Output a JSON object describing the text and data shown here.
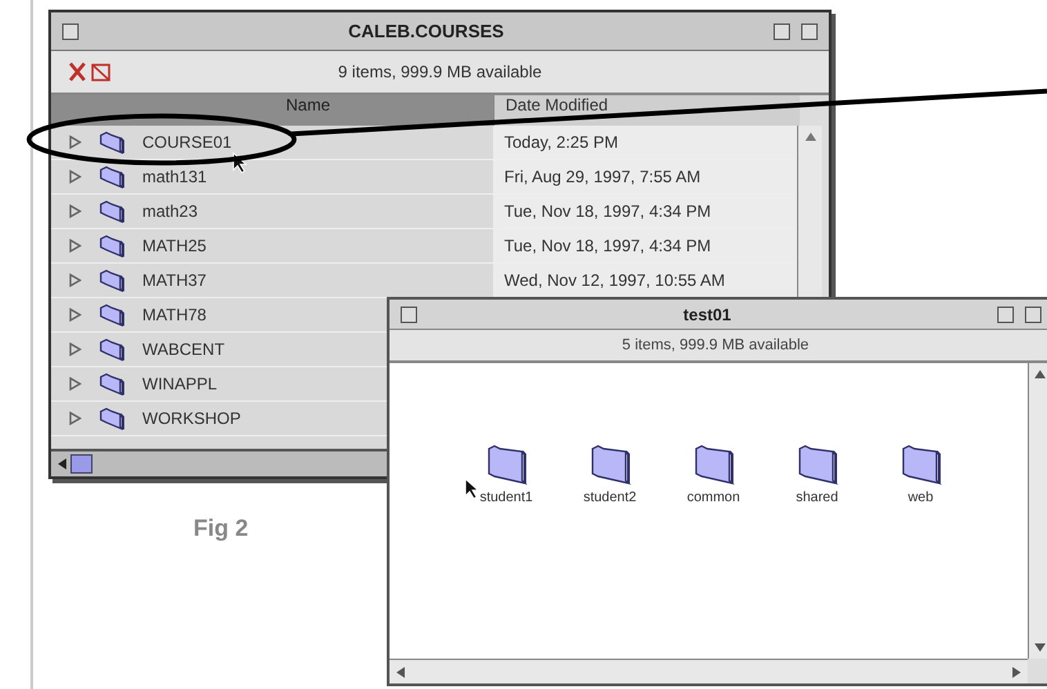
{
  "figure_caption": "Fig 2",
  "windows": [
    {
      "title": "CALEB.COURSES",
      "info": "9 items, 999.9 MB available",
      "columns": [
        "Name",
        "Date Modified"
      ],
      "rows": [
        {
          "name": "COURSE01",
          "date": "Today, 2:25 PM",
          "expanded": false
        },
        {
          "name": "math131",
          "date": "Fri, Aug 29, 1997, 7:55 AM",
          "expanded": false
        },
        {
          "name": "math23",
          "date": "Tue, Nov 18, 1997, 4:34 PM",
          "expanded": false
        },
        {
          "name": "MATH25",
          "date": "Tue, Nov 18, 1997, 4:34 PM",
          "expanded": false
        },
        {
          "name": "MATH37",
          "date": "Wed, Nov 12, 1997, 10:55 AM",
          "expanded": false
        },
        {
          "name": "MATH78",
          "date": "",
          "expanded": false
        },
        {
          "name": "WABCENT",
          "date": "",
          "expanded": false
        },
        {
          "name": "WINAPPL",
          "date": "",
          "expanded": false
        },
        {
          "name": "WORKSHOP",
          "date": "",
          "expanded": false
        }
      ]
    },
    {
      "title": "test01",
      "info": "5 items, 999.9 MB available",
      "icons": [
        {
          "name": "student1"
        },
        {
          "name": "student2"
        },
        {
          "name": "common"
        },
        {
          "name": "shared"
        },
        {
          "name": "web"
        }
      ]
    }
  ]
}
